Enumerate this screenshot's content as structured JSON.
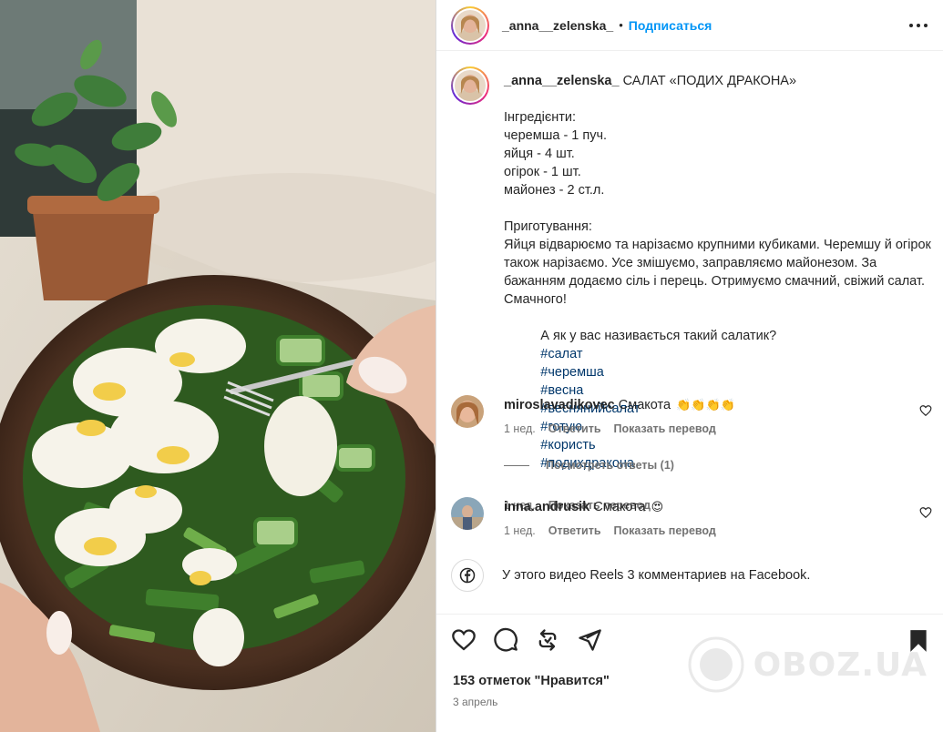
{
  "header": {
    "username": "_anna__zelenska_",
    "separator": "•",
    "follow_label": "Подписаться"
  },
  "caption": {
    "username": "_anna__zelenska_",
    "lines": [
      "САЛАТ «ПОДИХ ДРАКОНА»",
      "Інгредієнти:",
      "черемша - 1 пуч.",
      "яйця - 4 шт.",
      "огірок - 1 шт.",
      "майонез - 2 ст.л.",
      "Приготування:",
      "Яйця відварюємо та нарізаємо крупними кубиками. Черемшу й огірок також нарізаємо. Усе змішуємо, заправляємо майонезом. За бажанням додаємо сіль і перець. Отримуємо смачний, свіжий салат. Смачного!",
      "А як у вас називається такий салатик?"
    ],
    "hashtags": [
      "#салат",
      "#черемша",
      "#весна",
      "#веснянийсалат",
      "#готую",
      "#користь",
      "#подихдракона"
    ],
    "time": "1 нед.",
    "translate_label": "Показать перевод"
  },
  "comments": [
    {
      "username": "miroslavadikovec",
      "text": "Смакота",
      "emoji": "👏👏👏👏",
      "time": "1 нед.",
      "reply_label": "Ответить",
      "translate_label": "Показать перевод"
    },
    {
      "username": "inna.andrusik",
      "text": "Смакота",
      "emoji": "😍",
      "time": "1 нед.",
      "reply_label": "Ответить",
      "translate_label": "Показать перевод"
    }
  ],
  "view_replies_label": "Посмотреть ответы (1)",
  "facebook_note": "У этого видео Reels 3 комментариев на Facebook.",
  "footer": {
    "likes": "153 отметок \"Нравится\"",
    "date": "3 апрель",
    "watermark": "OBOZ.UA"
  },
  "colors": {
    "link": "#0095f6",
    "hashtag": "#00376b",
    "muted": "#737373",
    "text": "#262626"
  },
  "icons": [
    "more-icon",
    "heart-icon",
    "comment-icon",
    "repost-icon",
    "share-icon",
    "bookmark-icon",
    "facebook-icon"
  ]
}
